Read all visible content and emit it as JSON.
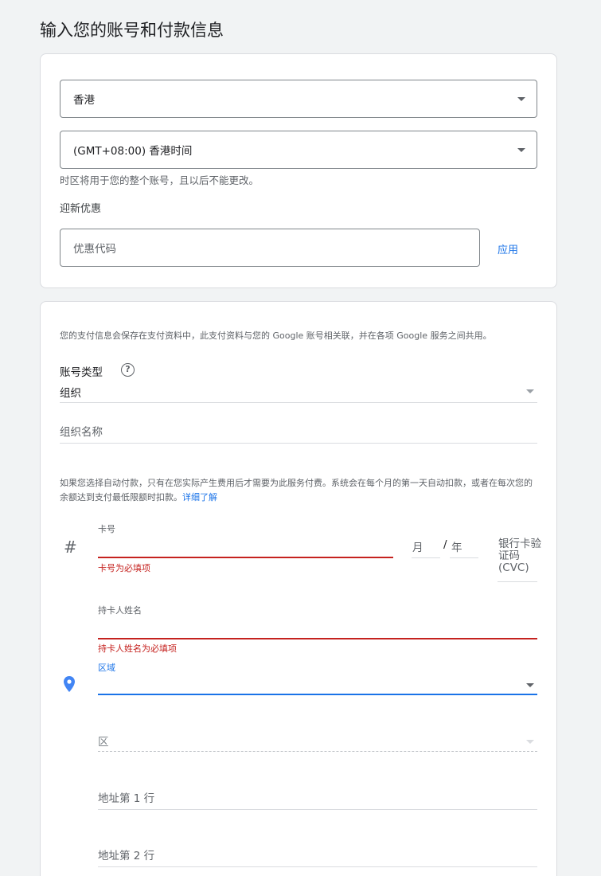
{
  "page": {
    "title": "输入您的账号和付款信息"
  },
  "account": {
    "country": "香港",
    "timezone": "(GMT+08:00) 香港时间",
    "timezone_note": "时区将用于您的整个账号，且以后不能更改。",
    "promo_heading": "迎新优惠",
    "promo_placeholder": "优惠代码",
    "apply_label": "应用"
  },
  "payment": {
    "profile_note": "您的支付信息会保存在支付资料中，此支付资料与您的 Google 账号相关联，并在各项 Google 服务之间共用。",
    "account_type_label": "账号类型",
    "help_glyph": "?",
    "account_type_value": "组织",
    "org_name_placeholder": "组织名称",
    "autopay_note": "如果您选择自动付款，只有在您实际产生费用后才需要为此服务付费。系统会在每个月的第一天自动扣款，或者在每次您的余额达到支付最低限额时扣款。",
    "learn_more": "详细了解",
    "card_glyph": "#",
    "card_number_label": "卡号",
    "card_number_error": "卡号为必填项",
    "month_placeholder": "月",
    "slash": "/",
    "year_placeholder": "年",
    "cvc_placeholder": "银行卡验证码 (CVC)",
    "cardholder_label": "持卡人姓名",
    "cardholder_error": "持卡人姓名为必填项",
    "region_label": "区域",
    "district_placeholder": "区",
    "address1_placeholder": "地址第 1 行",
    "address2_placeholder": "地址第 2 行"
  },
  "colors": {
    "accent": "#1a73e8",
    "error": "#c5221f",
    "location_pin": "#4285f4"
  }
}
